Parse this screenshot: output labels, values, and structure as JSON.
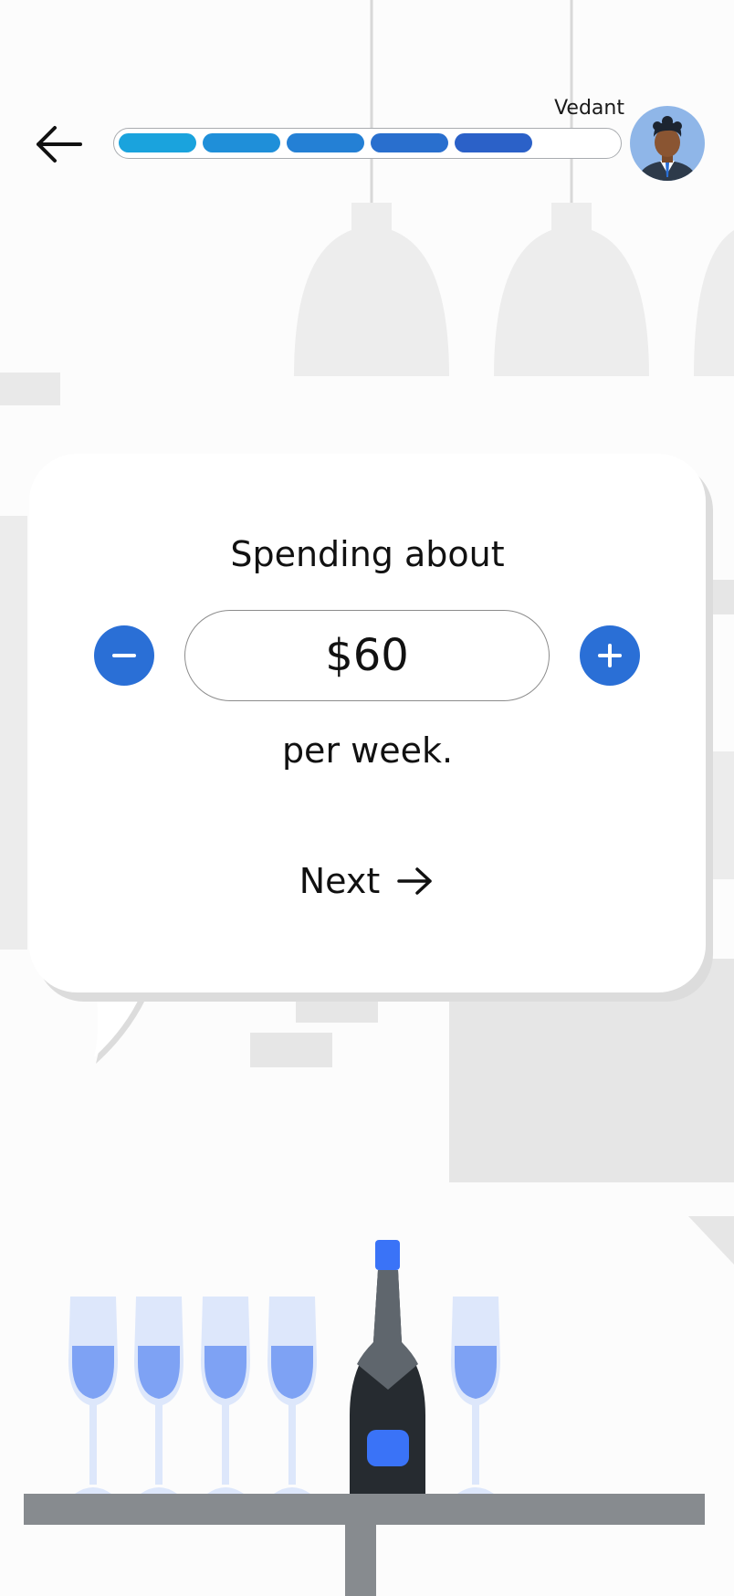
{
  "header": {
    "back_icon": "arrow-left-icon",
    "user_name": "Vedant",
    "avatar_icon": "user-avatar-icon",
    "progress": {
      "completed_steps": 5,
      "total_steps": 6
    },
    "progress_colors": [
      "#1aa3dd",
      "#1f8fd9",
      "#2480d5",
      "#296fce",
      "#2b61c8"
    ]
  },
  "card": {
    "prompt": "Spending about",
    "amount": "$60",
    "period": "per week.",
    "decrement_icon": "minus-icon",
    "increment_icon": "plus-icon",
    "next_label": "Next",
    "next_icon": "arrow-right-icon"
  },
  "colors": {
    "accent": "#2a6fd6",
    "bottle_cap": "#3a73f7",
    "glass_liquid": "#7ea2f4",
    "shelf": "#878b8f"
  }
}
